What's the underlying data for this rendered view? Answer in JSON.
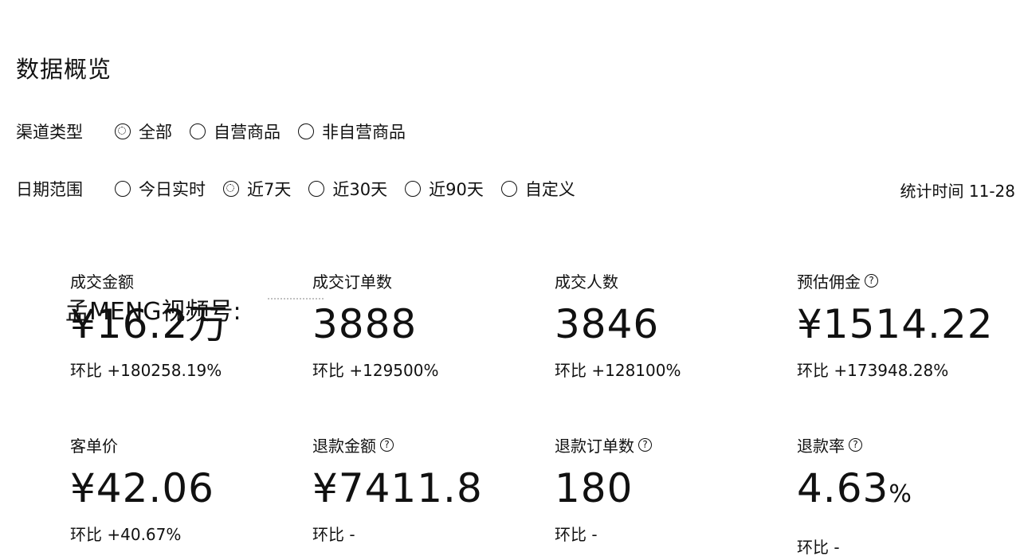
{
  "page": {
    "title": "数据概览"
  },
  "filters": {
    "channel": {
      "label": "渠道类型",
      "options": [
        "全部",
        "自营商品",
        "非自营商品"
      ],
      "selected": "全部"
    },
    "date": {
      "label": "日期范围",
      "options": [
        "今日实时",
        "近7天",
        "近30天",
        "近90天",
        "自定义"
      ],
      "selected": "近7天"
    }
  },
  "stat_time": "统计时间 11-28",
  "watermark": "孟MENG视频号:",
  "metrics": [
    {
      "title": "成交金额",
      "value": "¥16.2万",
      "change": "环比 +180258.19%",
      "help": false
    },
    {
      "title": "成交订单数",
      "value": "3888",
      "change": "环比 +129500%",
      "help": false
    },
    {
      "title": "成交人数",
      "value": "3846",
      "change": "环比 +128100%",
      "help": false
    },
    {
      "title": "预估佣金",
      "value": "¥1514.22",
      "change": "环比 +173948.28%",
      "help": true
    },
    {
      "title": "客单价",
      "value": "¥42.06",
      "change": "环比 +40.67%",
      "help": false
    },
    {
      "title": "退款金额",
      "value": "¥7411.8",
      "change": "环比 -",
      "help": true
    },
    {
      "title": "退款订单数",
      "value": "180",
      "change": "环比 -",
      "help": true
    },
    {
      "title": "退款率",
      "value": "4.63",
      "unit": "%",
      "change": "环比 -",
      "help": true
    }
  ],
  "icons": {
    "help": "question-circle-icon",
    "radio": "radio-icon"
  }
}
